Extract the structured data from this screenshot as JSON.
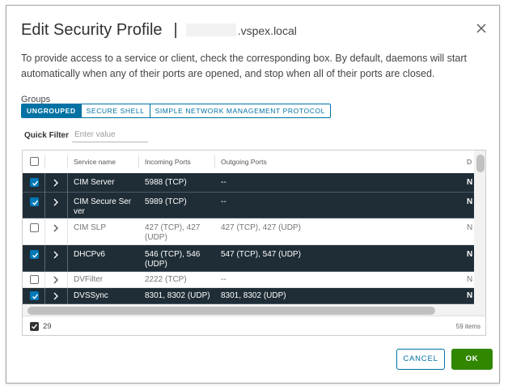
{
  "dialog": {
    "title": "Edit Security Profile",
    "separator": "|",
    "host_suffix": ".vspex.local",
    "description": "To provide access to a service or client, check the corresponding box. By default, daemons will start automatically when any of their ports are opened, and stop when all of their ports are closed."
  },
  "groups": {
    "label": "Groups",
    "tabs": [
      {
        "label": "UNGROUPED",
        "active": true
      },
      {
        "label": "SECURE SHELL",
        "active": false
      },
      {
        "label": "SIMPLE NETWORK MANAGEMENT PROTOCOL",
        "active": false
      }
    ]
  },
  "filter": {
    "label": "Quick Filter",
    "placeholder": "Enter value",
    "value": ""
  },
  "grid": {
    "columns": [
      "Service name",
      "Incoming Ports",
      "Outgoing Ports",
      "D"
    ],
    "rows": [
      {
        "name": "CIM Server",
        "incoming": "5988 (TCP)",
        "outgoing": "--",
        "daemon": "N",
        "checked": true
      },
      {
        "name": "CIM Secure Ser ver",
        "incoming": "5989 (TCP)",
        "outgoing": "--",
        "daemon": "N",
        "checked": true
      },
      {
        "name": "CIM SLP",
        "incoming": "427 (TCP), 427 (UDP)",
        "outgoing": "427 (TCP), 427 (UDP)",
        "daemon": "N",
        "checked": false
      },
      {
        "name": "DHCPv6",
        "incoming": "546 (TCP), 546 (UDP)",
        "outgoing": "547 (TCP), 547 (UDP)",
        "daemon": "N",
        "checked": true
      },
      {
        "name": "DVFilter",
        "incoming": "2222 (TCP)",
        "outgoing": "--",
        "daemon": "N",
        "checked": false
      },
      {
        "name": "DVSSync",
        "incoming": "8301, 8302 (UDP)",
        "outgoing": "8301, 8302 (UDP)",
        "daemon": "N",
        "checked": true
      }
    ],
    "footer": {
      "selected_count": "29",
      "total_items": "59 items"
    }
  },
  "buttons": {
    "cancel": "CANCEL",
    "ok": "OK"
  },
  "colors": {
    "accent": "#0072a3",
    "selected_row": "#1f2d36",
    "ok": "#318700",
    "checkbox": "#0079b8"
  }
}
